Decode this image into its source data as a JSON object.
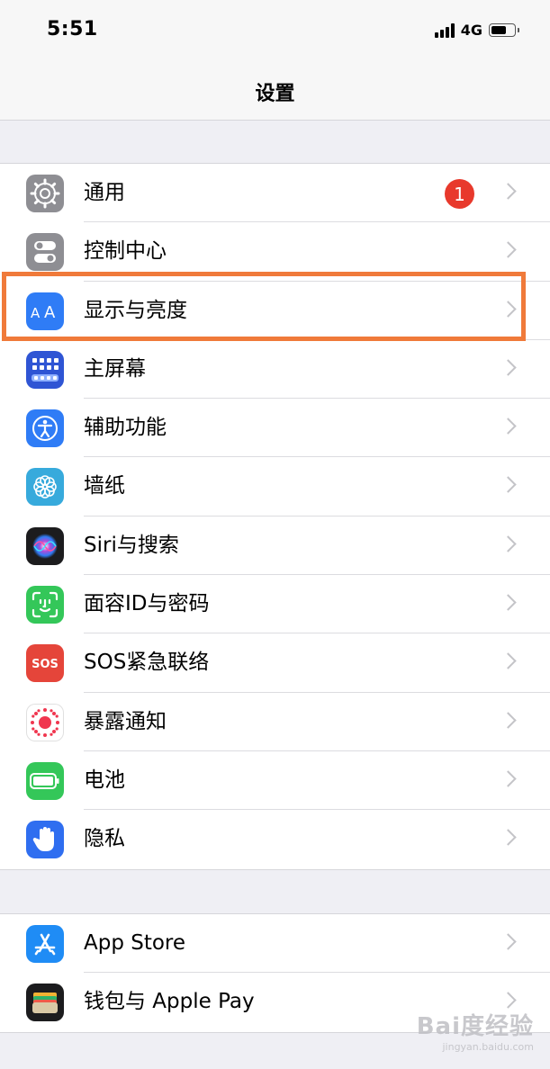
{
  "status_bar": {
    "time": "5:51",
    "network": "4G"
  },
  "nav": {
    "title": "设置"
  },
  "groups": [
    {
      "items": [
        {
          "label": "通用",
          "icon": "gear-icon",
          "icon_color": "#8e8e93",
          "badge": "1"
        },
        {
          "label": "控制中心",
          "icon": "switches-icon",
          "icon_color": "#8e8e93"
        },
        {
          "label": "显示与亮度",
          "icon": "display-aa-icon",
          "icon_color": "#2f7cf6"
        },
        {
          "label": "主屏幕",
          "icon": "home-screen-grid-icon",
          "icon_color": "#2f55d4"
        },
        {
          "label": "辅助功能",
          "icon": "accessibility-icon",
          "icon_color": "#2f7cf6"
        },
        {
          "label": "墙纸",
          "icon": "wallpaper-flower-icon",
          "icon_color": "#37aadc"
        },
        {
          "label": "Siri与搜索",
          "icon": "siri-icon",
          "icon_color": "#1c1c1e"
        },
        {
          "label": "面容ID与密码",
          "icon": "face-id-icon",
          "icon_color": "#34c759"
        },
        {
          "label": "SOS紧急联络",
          "icon": "sos-icon",
          "icon_color": "#e5453a"
        },
        {
          "label": "暴露通知",
          "icon": "exposure-notification-icon",
          "icon_color": "#ffffff"
        },
        {
          "label": "电池",
          "icon": "battery-icon",
          "icon_color": "#34c759"
        },
        {
          "label": "隐私",
          "icon": "privacy-hand-icon",
          "icon_color": "#2f6ef0"
        }
      ]
    },
    {
      "items": [
        {
          "label": "App Store",
          "icon": "app-store-icon",
          "icon_color": "#1f8cf5"
        },
        {
          "label": "钱包与 Apple Pay",
          "icon": "wallet-icon",
          "icon_color": "#1c1c1e"
        }
      ]
    }
  ],
  "highlight_color": "#f07a3a",
  "watermark": {
    "text": "Bai度经验",
    "sub": "jingyan.baidu.com"
  }
}
